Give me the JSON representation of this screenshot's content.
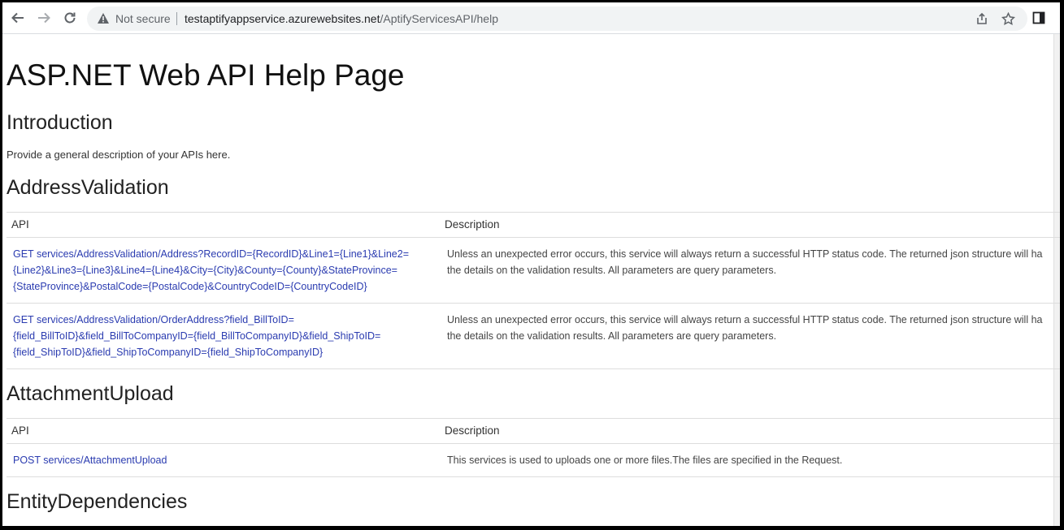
{
  "browser": {
    "security_label": "Not secure",
    "url_host": "testaptifyappservice.azurewebsites.net",
    "url_path": "/AptifyServicesAPI/help"
  },
  "page": {
    "title": "ASP.NET Web API Help Page",
    "intro_heading": "Introduction",
    "intro_text": "Provide a general description of your APIs here.",
    "sections": [
      {
        "heading": "AddressValidation",
        "col_api": "API",
        "col_desc": "Description",
        "rows": [
          {
            "api_lines": [
              "GET services/AddressValidation/Address?RecordID={RecordID}&Line1={Line1}&Line2=",
              "{Line2}&Line3={Line3}&Line4={Line4}&City={City}&County={County}&StateProvince=",
              "{StateProvince}&PostalCode={PostalCode}&CountryCodeID={CountryCodeID}"
            ],
            "desc_lines": [
              "Unless an unexpected error occurs, this service will always return a successful HTTP status code. The returned json structure will ha",
              "the details on the validation results. All parameters are query parameters."
            ]
          },
          {
            "api_lines": [
              "GET services/AddressValidation/OrderAddress?field_BillToID=",
              "{field_BillToID}&field_BillToCompanyID={field_BillToCompanyID}&field_ShipToID=",
              "{field_ShipToID}&field_ShipToCompanyID={field_ShipToCompanyID}"
            ],
            "desc_lines": [
              "Unless an unexpected error occurs, this service will always return a successful HTTP status code. The returned json structure will ha",
              "the details on the validation results. All parameters are query parameters."
            ]
          }
        ]
      },
      {
        "heading": "AttachmentUpload",
        "col_api": "API",
        "col_desc": "Description",
        "rows": [
          {
            "api_lines": [
              "POST services/AttachmentUpload"
            ],
            "desc_lines": [
              "This services is used to uploads one or more files.The files are specified in the Request."
            ]
          }
        ]
      },
      {
        "heading": "EntityDependencies"
      }
    ]
  },
  "icons": {
    "back": "back-arrow-icon",
    "forward": "forward-arrow-icon",
    "reload": "reload-icon",
    "warning": "warning-triangle-icon",
    "share": "share-icon",
    "bookmark": "star-icon",
    "sidepanel": "side-panel-icon"
  },
  "colors": {
    "link": "#2a3bb0",
    "omnibox_bg": "#f1f3f4"
  }
}
